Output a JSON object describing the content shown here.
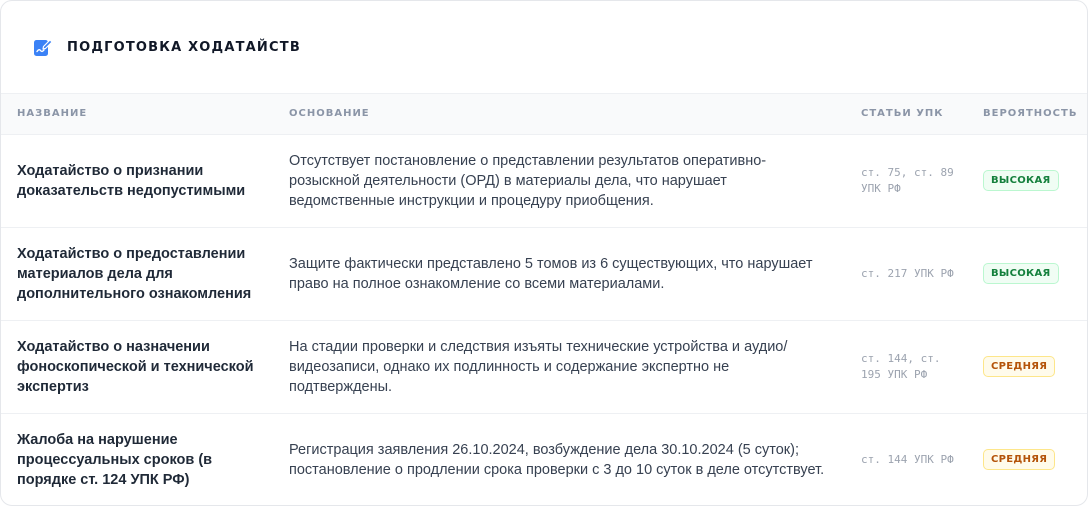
{
  "header": {
    "title": "ПОДГОТОВКА ХОДАТАЙСТВ",
    "icon": "edit-document-icon",
    "icon_color": "#3b82f6"
  },
  "table": {
    "columns": [
      "НАЗВАНИЕ",
      "ОСНОВАНИЕ",
      "СТАТЬИ УПК",
      "ВЕРОЯТНОСТЬ"
    ],
    "rows": [
      {
        "name": "Ходатайство о признании доказательств недопустимыми",
        "basis": "Отсутствует постановление о представлении результатов оперативно-розыскной деятельности (ОРД) в материалы дела, что нарушает ведомственные инструкции и процедуру приобщения.",
        "articles": "ст. 75, ст. 89 УПК РФ",
        "probability": "ВЫСОКАЯ",
        "level": "high"
      },
      {
        "name": "Ходатайство о предоставлении материалов дела для дополнительного ознакомления",
        "basis": "Защите фактически представлено 5 томов из 6 существующих, что нарушает право на полное ознакомление со всеми материалами.",
        "articles": "ст. 217 УПК РФ",
        "probability": "ВЫСОКАЯ",
        "level": "high"
      },
      {
        "name": "Ходатайство о назначении фоноскопической и технической экспертиз",
        "basis": "На стадии проверки и следствия изъяты технические устройства и аудио/видеозаписи, однако их подлинность и содержание экспертно не подтверждены.",
        "articles": "ст. 144, ст. 195 УПК РФ",
        "probability": "СРЕДНЯЯ",
        "level": "medium"
      },
      {
        "name": "Жалоба на нарушение процессуальных сроков (в порядке ст. 124 УПК РФ)",
        "basis": "Регистрация заявления 26.10.2024, возбуждение дела 30.10.2024 (5 суток); постановление о продлении срока проверки с 3 до 10 суток в деле отсутствует.",
        "articles": "ст. 144 УПК РФ",
        "probability": "СРЕДНЯЯ",
        "level": "medium"
      }
    ]
  },
  "colors": {
    "high_text": "#15803d",
    "medium_text": "#b45309",
    "header_bg": "#f9fafb"
  }
}
